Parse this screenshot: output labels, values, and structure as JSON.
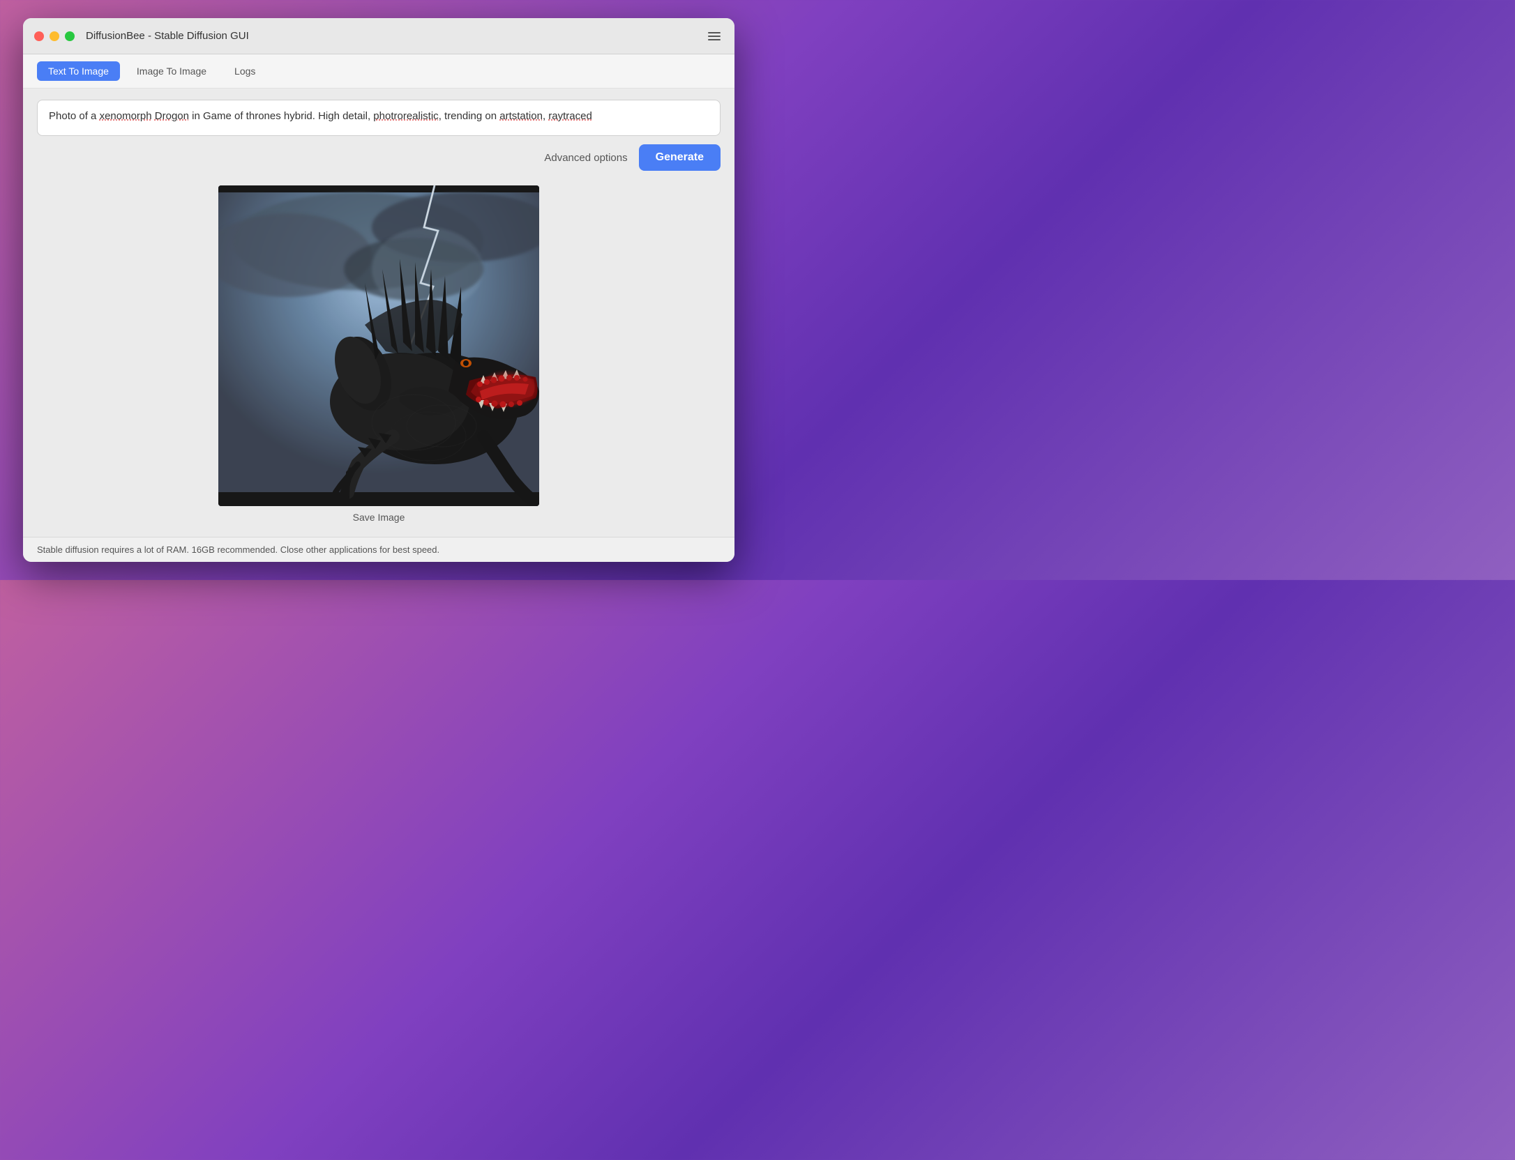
{
  "window": {
    "title": "DiffusionBee - Stable Diffusion GUI"
  },
  "tabs": {
    "text_to_image": "Text To Image",
    "image_to_image": "Image To Image",
    "logs": "Logs",
    "active": "text_to_image"
  },
  "prompt": {
    "value": "Photo of a xenomorph Drogon in Game of thrones hybrid. High detail, photrorealistic, trending on artstation, raytraced"
  },
  "toolbar": {
    "advanced_options_label": "Advanced options",
    "generate_label": "Generate"
  },
  "image": {
    "save_label": "Save Image"
  },
  "footer": {
    "message": "Stable diffusion requires a lot of RAM. 16GB recommended. Close other applications for best speed."
  }
}
